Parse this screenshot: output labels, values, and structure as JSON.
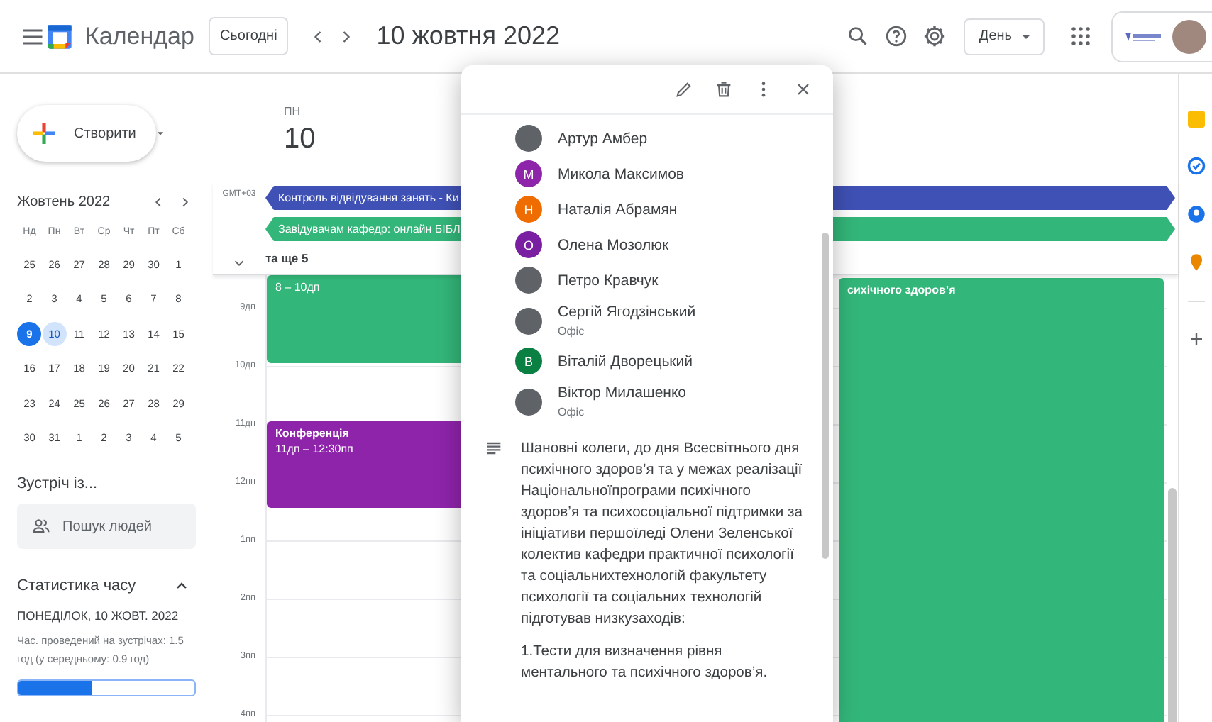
{
  "header": {
    "app_name": "Календар",
    "today_button": "Сьогодні",
    "date_title": "10 жовтня 2022",
    "view_button": "День"
  },
  "create_button": "Створити",
  "mini_calendar": {
    "title": "Жовтень 2022",
    "weekdays": [
      "Нд",
      "Пн",
      "Вт",
      "Ср",
      "Чт",
      "Пт",
      "Сб"
    ],
    "weeks": [
      [
        {
          "label": "25",
          "today": false,
          "selected": false
        },
        {
          "label": "26",
          "today": false,
          "selected": false
        },
        {
          "label": "27",
          "today": false,
          "selected": false
        },
        {
          "label": "28",
          "today": false,
          "selected": false
        },
        {
          "label": "29",
          "today": false,
          "selected": false
        },
        {
          "label": "30",
          "today": false,
          "selected": false
        },
        {
          "label": "1",
          "today": false,
          "selected": false
        }
      ],
      [
        {
          "label": "2",
          "today": false,
          "selected": false
        },
        {
          "label": "3",
          "today": false,
          "selected": false
        },
        {
          "label": "4",
          "today": false,
          "selected": false
        },
        {
          "label": "5",
          "today": false,
          "selected": false
        },
        {
          "label": "6",
          "today": false,
          "selected": false
        },
        {
          "label": "7",
          "today": false,
          "selected": false
        },
        {
          "label": "8",
          "today": false,
          "selected": false
        }
      ],
      [
        {
          "label": "9",
          "today": true,
          "selected": false
        },
        {
          "label": "10",
          "today": false,
          "selected": true
        },
        {
          "label": "11",
          "today": false,
          "selected": false
        },
        {
          "label": "12",
          "today": false,
          "selected": false
        },
        {
          "label": "13",
          "today": false,
          "selected": false
        },
        {
          "label": "14",
          "today": false,
          "selected": false
        },
        {
          "label": "15",
          "today": false,
          "selected": false
        }
      ],
      [
        {
          "label": "16",
          "today": false,
          "selected": false
        },
        {
          "label": "17",
          "today": false,
          "selected": false
        },
        {
          "label": "18",
          "today": false,
          "selected": false
        },
        {
          "label": "19",
          "today": false,
          "selected": false
        },
        {
          "label": "20",
          "today": false,
          "selected": false
        },
        {
          "label": "21",
          "today": false,
          "selected": false
        },
        {
          "label": "22",
          "today": false,
          "selected": false
        }
      ],
      [
        {
          "label": "23",
          "today": false,
          "selected": false
        },
        {
          "label": "24",
          "today": false,
          "selected": false
        },
        {
          "label": "25",
          "today": false,
          "selected": false
        },
        {
          "label": "26",
          "today": false,
          "selected": false
        },
        {
          "label": "27",
          "today": false,
          "selected": false
        },
        {
          "label": "28",
          "today": false,
          "selected": false
        },
        {
          "label": "29",
          "today": false,
          "selected": false
        }
      ],
      [
        {
          "label": "30",
          "today": false,
          "selected": false
        },
        {
          "label": "31",
          "today": false,
          "selected": false
        },
        {
          "label": "1",
          "today": false,
          "selected": false
        },
        {
          "label": "2",
          "today": false,
          "selected": false
        },
        {
          "label": "3",
          "today": false,
          "selected": false
        },
        {
          "label": "4",
          "today": false,
          "selected": false
        },
        {
          "label": "5",
          "today": false,
          "selected": false
        }
      ]
    ]
  },
  "meet_with": {
    "title": "Зустріч із...",
    "placeholder": "Пошук людей"
  },
  "time_insights": {
    "title": "Статистика часу",
    "expanded": true,
    "date": "ПОНЕДІЛОК, 10 ЖОВТ. 2022",
    "summary": "Час. проведений на зустрічах: 1.5 год (у середньому: 0.9 год)",
    "level": 0.42
  },
  "day": {
    "weekday": "ПН",
    "date": "10",
    "timezone": "GMT+03",
    "more": "та ще 5",
    "all_day_events": [
      {
        "title": "Контроль відвідування занять - Ки",
        "color": "#3f51b5"
      },
      {
        "title": "Завідувачам кафедр: онлайн БІБЛ",
        "color": "#33b679"
      }
    ],
    "hours": [
      "9дп",
      "10дп",
      "11дп",
      "12пп",
      "1пп",
      "2пп",
      "3пп",
      "4пп"
    ],
    "events": [
      {
        "time": "8 – 10дп",
        "color": "#33b679"
      },
      {
        "title": "Конференція",
        "time": "11дп – 12:30пп",
        "color": "#8e24aa"
      },
      {
        "title": "сихічного здоров’я",
        "color": "#33b679"
      }
    ]
  },
  "popup": {
    "guests": [
      {
        "name": "Артур Амбер",
        "kind": "photo"
      },
      {
        "name": "Микола Максимов",
        "kind": "letter",
        "initial": "М",
        "color": "#8e24aa"
      },
      {
        "name": "Наталія Абрамян",
        "kind": "letter",
        "initial": "Н",
        "color": "#ef6c00"
      },
      {
        "name": "Олена Мозолюк",
        "kind": "letter",
        "initial": "О",
        "color": "#7b1fa2"
      },
      {
        "name": "Петро Кравчук",
        "kind": "photo"
      },
      {
        "name": "Сергій Ягодзінський",
        "kind": "photo",
        "note": "Офіс"
      },
      {
        "name": "Віталій Дворецький",
        "kind": "letter",
        "initial": "В",
        "color": "#0b8043"
      },
      {
        "name": "Віктор Милашенко",
        "kind": "photo",
        "note": "Офіс"
      }
    ],
    "description": [
      "Шановні колеги, до дня Всесвітнього дня психічного здоров’я та у межах реалізації Національноїпрограми психічного здоров’я та психосоціальної підтримки за ініціативи першоїледі Олени Зеленської колектив кафедри практичної психології та соціальнихтехнологій факультету психології та соціальних технологій підготував низкузаходів:",
      "1.Тести для визначення рівня ментального та психічного здоров’я."
    ]
  }
}
